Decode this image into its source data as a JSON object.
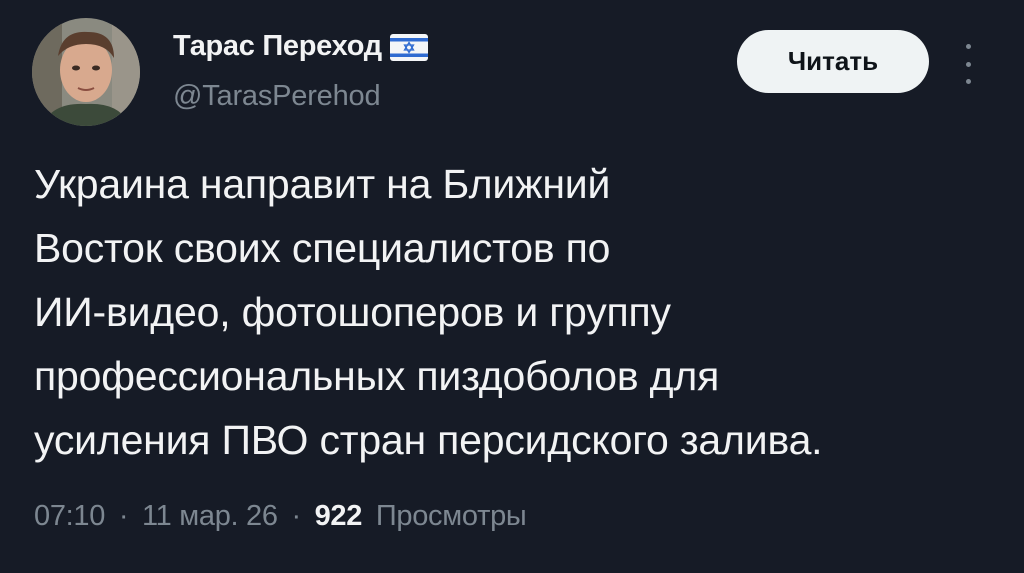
{
  "author": {
    "display_name": "Тарас Переход",
    "handle": "@TarasPerehod",
    "flag_icon": "israel-flag-icon",
    "avatar": "avatar-photo"
  },
  "actions": {
    "follow_label": "Читать",
    "more_icon": "more-vertical-icon"
  },
  "tweet": {
    "lines": [
      "Украина направит на Ближний",
      "Восток своих специалистов по",
      "ИИ-видео, фотошоперов и группу",
      "профессиональных пиздоболов для",
      "усиления ПВО стран персидского залива."
    ]
  },
  "meta": {
    "time": "07:10",
    "separator": "·",
    "date": "11 мар. 26",
    "views_count": "922",
    "views_label": "Просмотры"
  },
  "colors": {
    "background": "#161b26",
    "text": "#f2f3f4",
    "muted": "#7d8791",
    "button_bg": "#eff3f4"
  }
}
